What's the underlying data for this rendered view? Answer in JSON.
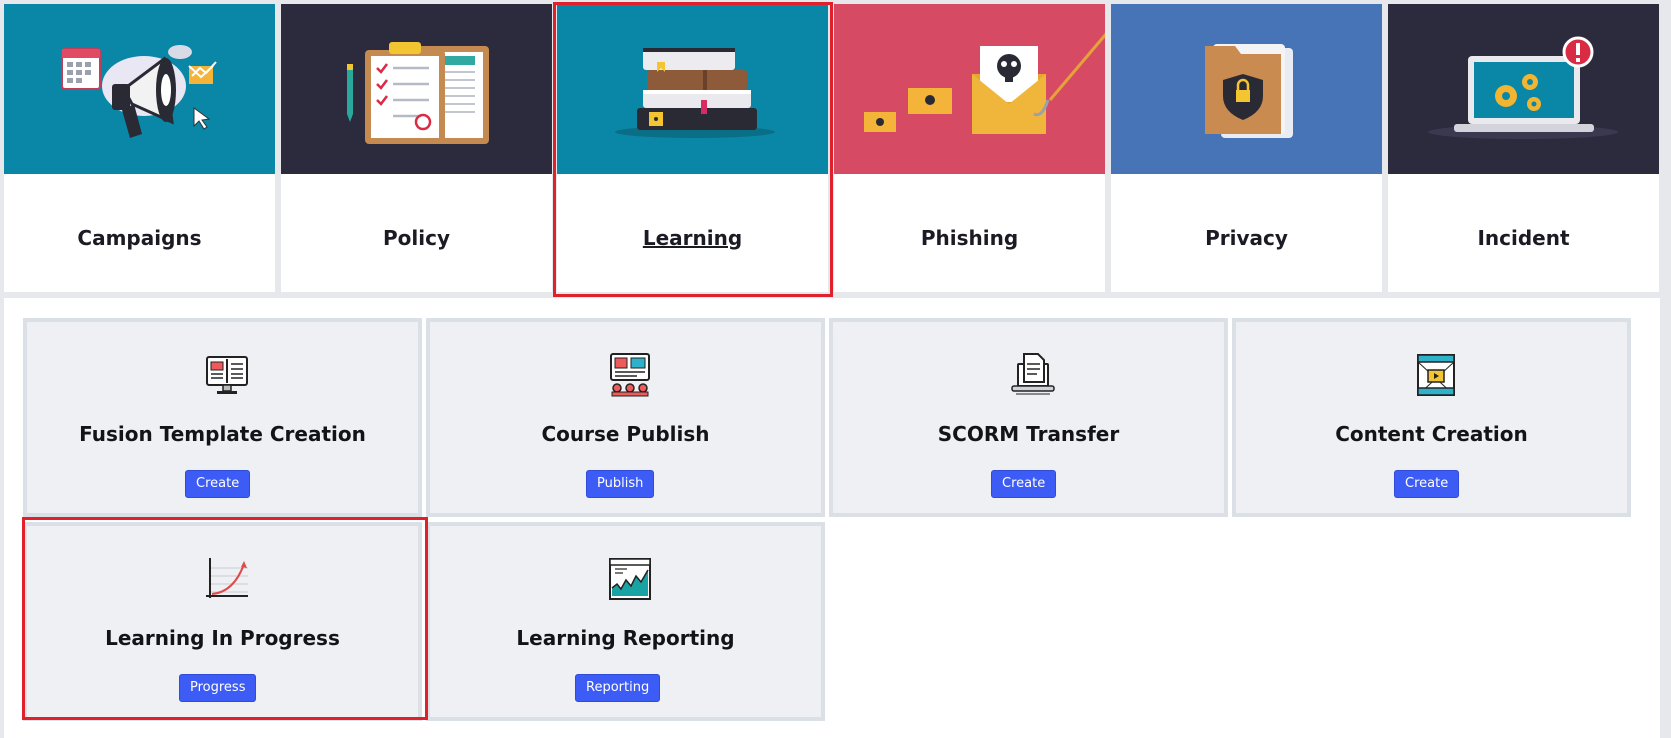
{
  "modules": [
    {
      "id": "campaigns",
      "label": "Campaigns",
      "icon": "megaphone-icon",
      "color": "#0a87a6"
    },
    {
      "id": "policy",
      "label": "Policy",
      "icon": "clipboard-checklist-icon",
      "color": "#2c2a3d"
    },
    {
      "id": "learning",
      "label": "Learning",
      "icon": "book-stack-icon",
      "color": "#0a87a6",
      "active": true
    },
    {
      "id": "phishing",
      "label": "Phishing",
      "icon": "phishing-envelope-icon",
      "color": "#d64b63"
    },
    {
      "id": "privacy",
      "label": "Privacy",
      "icon": "shield-folder-icon",
      "color": "#4773b7"
    },
    {
      "id": "incident",
      "label": "Incident",
      "icon": "laptop-gears-alert-icon",
      "color": "#2c2a3d"
    }
  ],
  "learning": {
    "items": [
      {
        "title": "Fusion Template Creation",
        "button": "Create",
        "icon": "monitor-book-icon"
      },
      {
        "title": "Course Publish",
        "button": "Publish",
        "icon": "presentation-audience-icon"
      },
      {
        "title": "SCORM Transfer",
        "button": "Create",
        "icon": "laptop-document-icon"
      },
      {
        "title": "Content Creation",
        "button": "Create",
        "icon": "video-wireframe-icon"
      },
      {
        "title": "Learning In Progress",
        "button": "Progress",
        "icon": "growth-curve-icon"
      },
      {
        "title": "Learning Reporting",
        "button": "Reporting",
        "icon": "report-chart-icon"
      }
    ]
  }
}
